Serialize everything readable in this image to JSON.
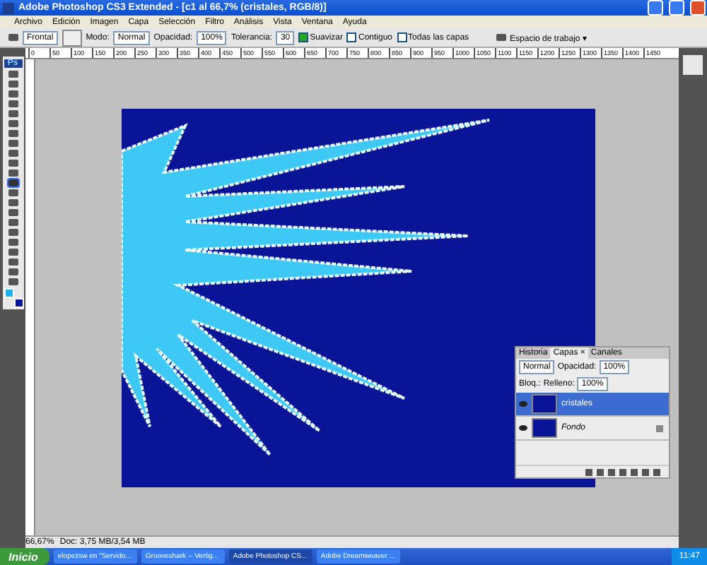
{
  "window": {
    "title": "Adobe Photoshop CS3 Extended - [c1 al 66,7% (cristales, RGB/8)]"
  },
  "menu": [
    "Archivo",
    "Edición",
    "Imagen",
    "Capa",
    "Selección",
    "Filtro",
    "Análisis",
    "Vista",
    "Ventana",
    "Ayuda"
  ],
  "options_bar": {
    "fill_source": "Frontal",
    "mode_label": "Modo:",
    "mode": "Normal",
    "opacity_label": "Opacidad:",
    "opacity": "100%",
    "tolerance_label": "Tolerancia:",
    "tolerance": "30",
    "checks": [
      {
        "label": "Suavizar",
        "checked": true
      },
      {
        "label": "Contiguo",
        "checked": false
      },
      {
        "label": "Todas las capas",
        "checked": false
      }
    ],
    "workspace": "Espacio de trabajo ▾"
  },
  "top_ruler": {
    "labels": [
      "0",
      "50",
      "100",
      "150",
      "200",
      "250",
      "300",
      "350",
      "400",
      "450",
      "500",
      "550",
      "600",
      "650",
      "700",
      "750",
      "800",
      "850",
      "900",
      "950",
      "1000",
      "1050",
      "1100",
      "1150",
      "1200",
      "1250",
      "1300",
      "1350",
      "1400",
      "1450"
    ]
  },
  "toolbox": {
    "logo": "Ps",
    "tools": [
      {
        "selected": false
      },
      {
        "selected": false
      },
      {
        "selected": false
      },
      {
        "selected": false
      },
      {
        "selected": false
      },
      {
        "selected": false
      },
      {
        "selected": false
      },
      {
        "selected": false
      },
      {
        "selected": false
      },
      {
        "selected": false
      },
      {
        "selected": false
      },
      {
        "selected": true
      },
      {
        "selected": false
      },
      {
        "selected": false
      },
      {
        "selected": false
      },
      {
        "selected": false
      },
      {
        "selected": false
      },
      {
        "selected": false
      },
      {
        "selected": false
      },
      {
        "selected": false
      },
      {
        "selected": false
      },
      {
        "selected": false
      }
    ],
    "swatches": [
      {
        "color": "#1eb4f0"
      },
      {
        "color": "#0a1496"
      }
    ]
  },
  "layers_panel": {
    "tabs": [
      {
        "label": "Historia",
        "selected": false
      },
      {
        "label": "Capas ×",
        "selected": true
      },
      {
        "label": "Canales",
        "selected": false
      }
    ],
    "blend_mode": "Normal",
    "opacity_label": "Opacidad:",
    "opacity": "100%",
    "lock_label": "Bloq.:",
    "fill_label": "Relleno:",
    "fill": "100%",
    "layers": [
      {
        "name": "cristales",
        "selected": true,
        "visible": true,
        "locked": false
      },
      {
        "name": "Fondo",
        "selected": false,
        "visible": true,
        "locked": true
      }
    ]
  },
  "status_bar": {
    "zoom": "66,67%",
    "doc": "Doc: 3,75 MB/3,54 MB"
  },
  "taskbar": {
    "start": "Inicio",
    "items": [
      {
        "label": "elopezsw en \"Servido...",
        "selected": false
      },
      {
        "label": "Grooveshark -- Vertig...",
        "selected": false
      },
      {
        "label": "Adobe Photoshop CS...",
        "selected": true
      },
      {
        "label": "Adobe Dreamweaver ...",
        "selected": false
      }
    ],
    "clock": "11:47"
  }
}
